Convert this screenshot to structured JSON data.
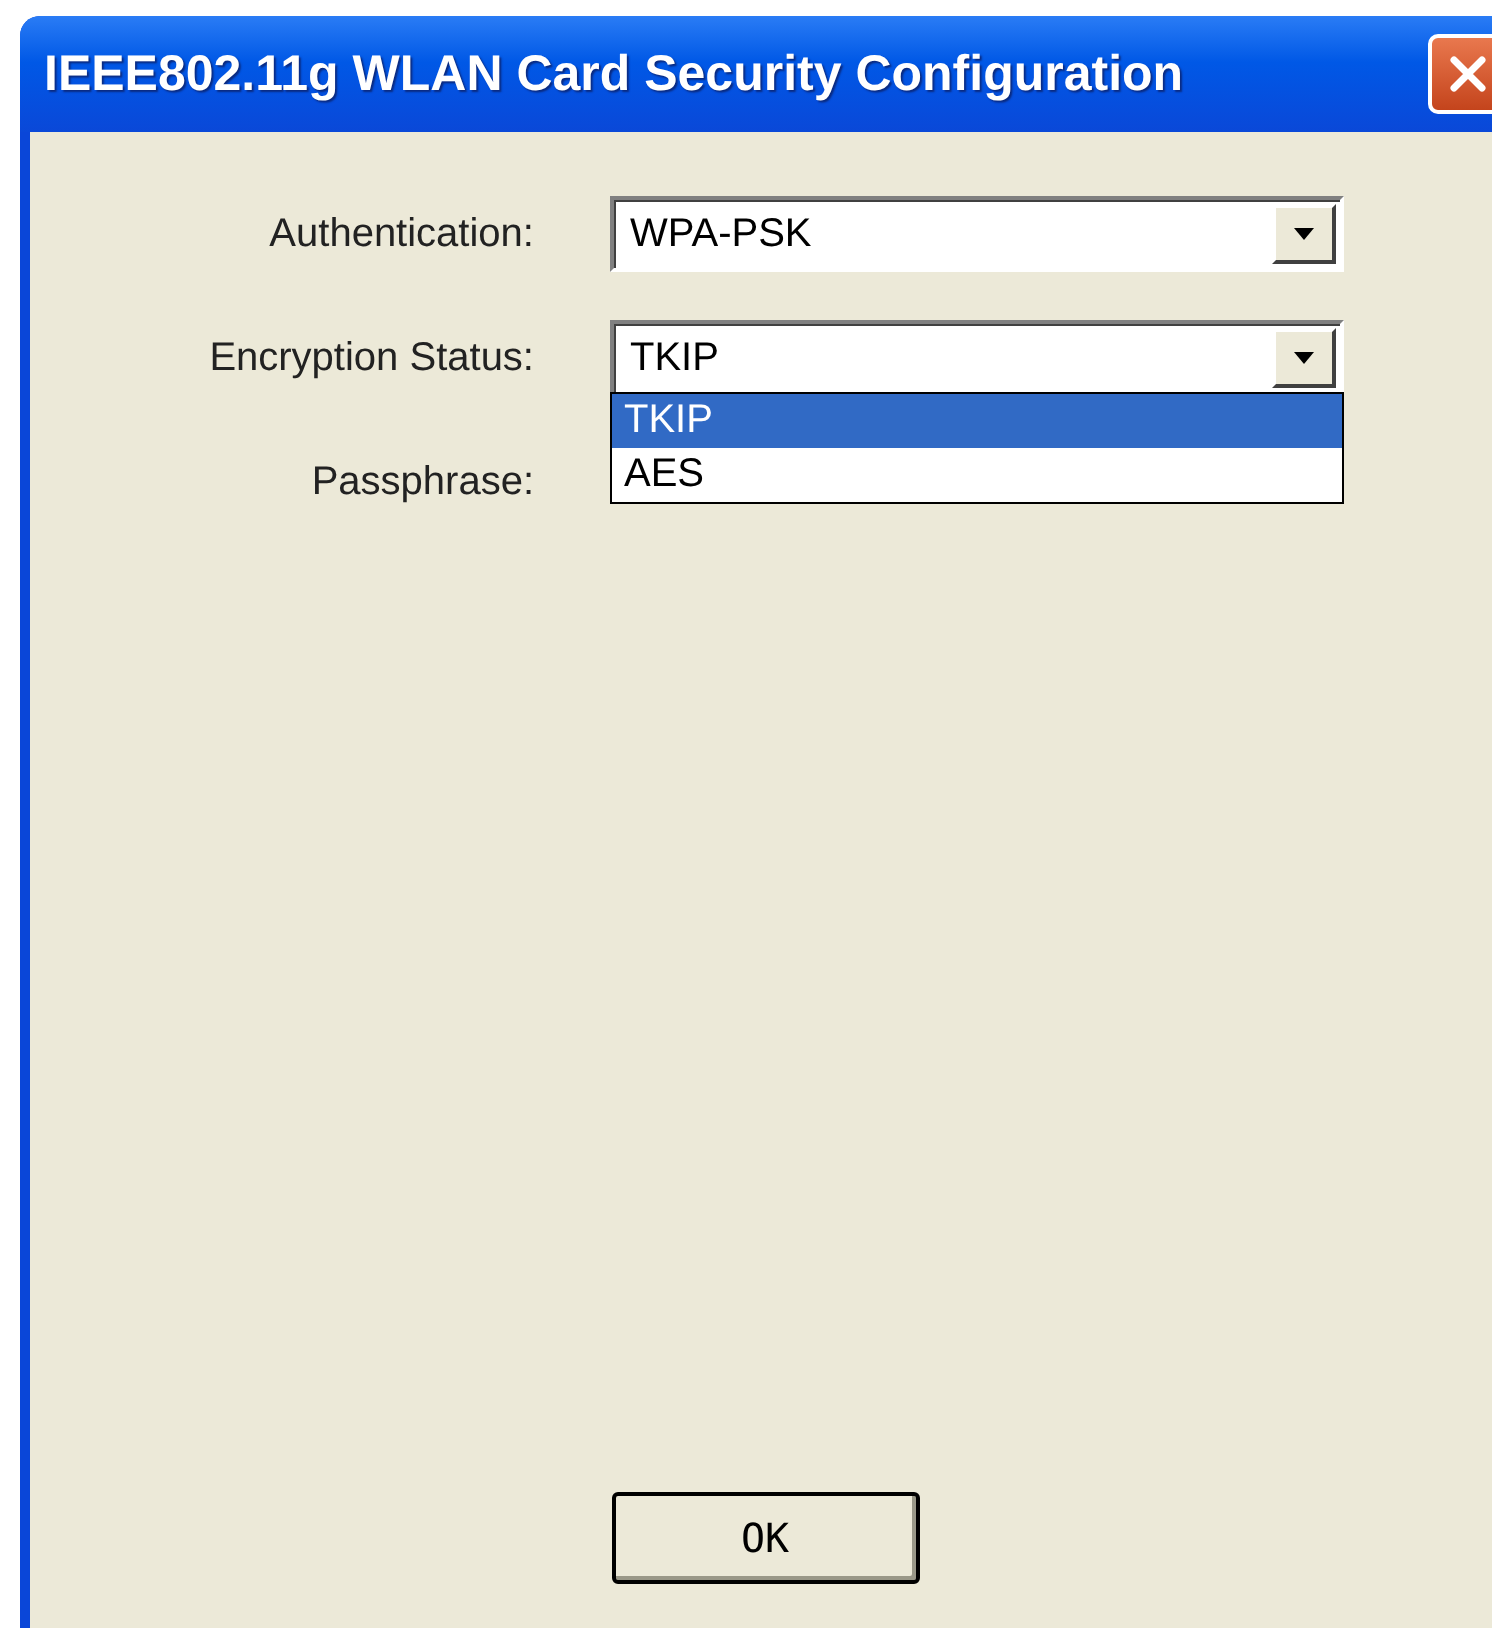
{
  "window": {
    "title": "IEEE802.11g WLAN Card Security Configuration"
  },
  "fields": [
    {
      "label": "Authentication:",
      "kind": "combo",
      "value": "WPA-PSK"
    },
    {
      "label": "Encryption Status:",
      "kind": "combo",
      "value": "TKIP",
      "expanded": true,
      "options": [
        {
          "label": "TKIP",
          "selected": true
        },
        {
          "label": "AES",
          "selected": false
        }
      ]
    },
    {
      "label": "Passphrase:",
      "kind": "text"
    }
  ],
  "buttons": [
    "OK"
  ]
}
